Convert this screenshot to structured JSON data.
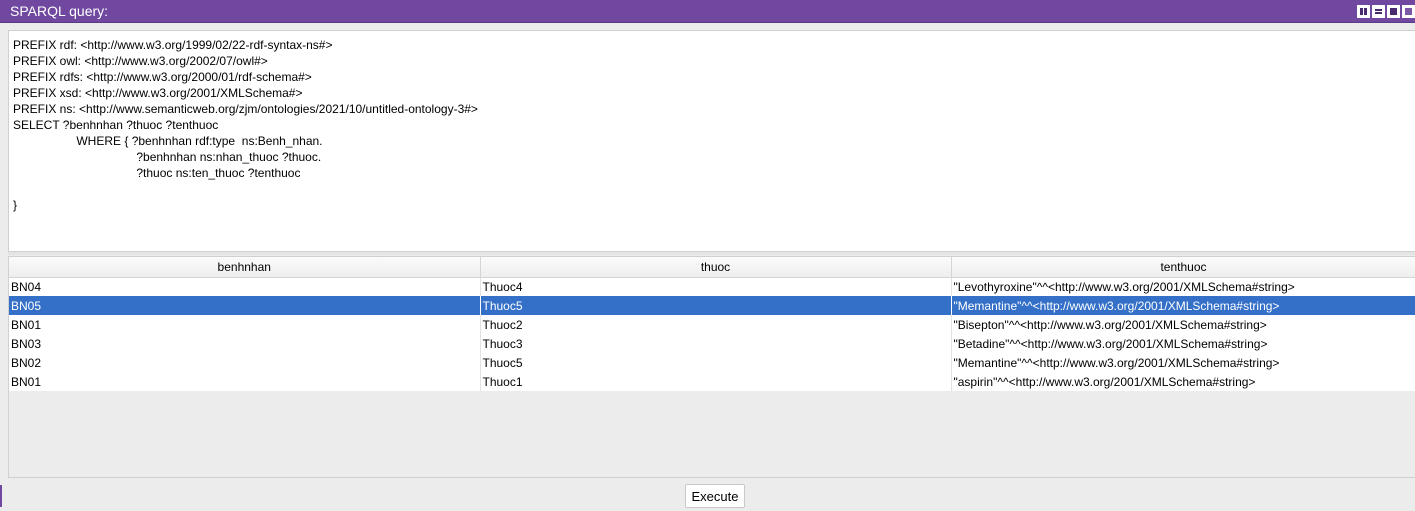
{
  "window": {
    "title": "SPARQL query:",
    "buttons": [
      "tile-icon",
      "minimize-icon",
      "maximize-icon",
      "close-icon"
    ]
  },
  "query": {
    "lines": [
      "PREFIX rdf: <http://www.w3.org/1999/02/22-rdf-syntax-ns#>",
      "PREFIX owl: <http://www.w3.org/2002/07/owl#>",
      "PREFIX rdfs: <http://www.w3.org/2000/01/rdf-schema#>",
      "PREFIX xsd: <http://www.w3.org/2001/XMLSchema#>",
      "PREFIX ns: <http://www.semanticweb.org/zjm/ontologies/2021/10/untitled-ontology-3#>",
      "SELECT ?benhnhan ?thuoc ?tenthuoc",
      "                   WHERE { ?benhnhan rdf:type  ns:Benh_nhan.",
      "                                     ?benhnhan ns:nhan_thuoc ?thuoc.",
      "                                     ?thuoc ns:ten_thuoc ?tenthuoc",
      "",
      "}"
    ]
  },
  "results": {
    "columns": [
      "benhnhan",
      "thuoc",
      "tenthuoc"
    ],
    "selected_row": 1,
    "rows": [
      [
        "BN04",
        "Thuoc4",
        "\"Levothyroxine\"^^<http://www.w3.org/2001/XMLSchema#string>"
      ],
      [
        "BN05",
        "Thuoc5",
        "\"Memantine\"^^<http://www.w3.org/2001/XMLSchema#string>"
      ],
      [
        "BN01",
        "Thuoc2",
        "\"Bisepton\"^^<http://www.w3.org/2001/XMLSchema#string>"
      ],
      [
        "BN03",
        "Thuoc3",
        "\"Betadine\"^^<http://www.w3.org/2001/XMLSchema#string>"
      ],
      [
        "BN02",
        "Thuoc5",
        "\"Memantine\"^^<http://www.w3.org/2001/XMLSchema#string>"
      ],
      [
        "BN01",
        "Thuoc1",
        "\"aspirin\"^^<http://www.w3.org/2001/XMLSchema#string>"
      ]
    ]
  },
  "execute_label": "Execute",
  "colors": {
    "titlebar": "#7048a0",
    "selection": "#3470c7"
  }
}
